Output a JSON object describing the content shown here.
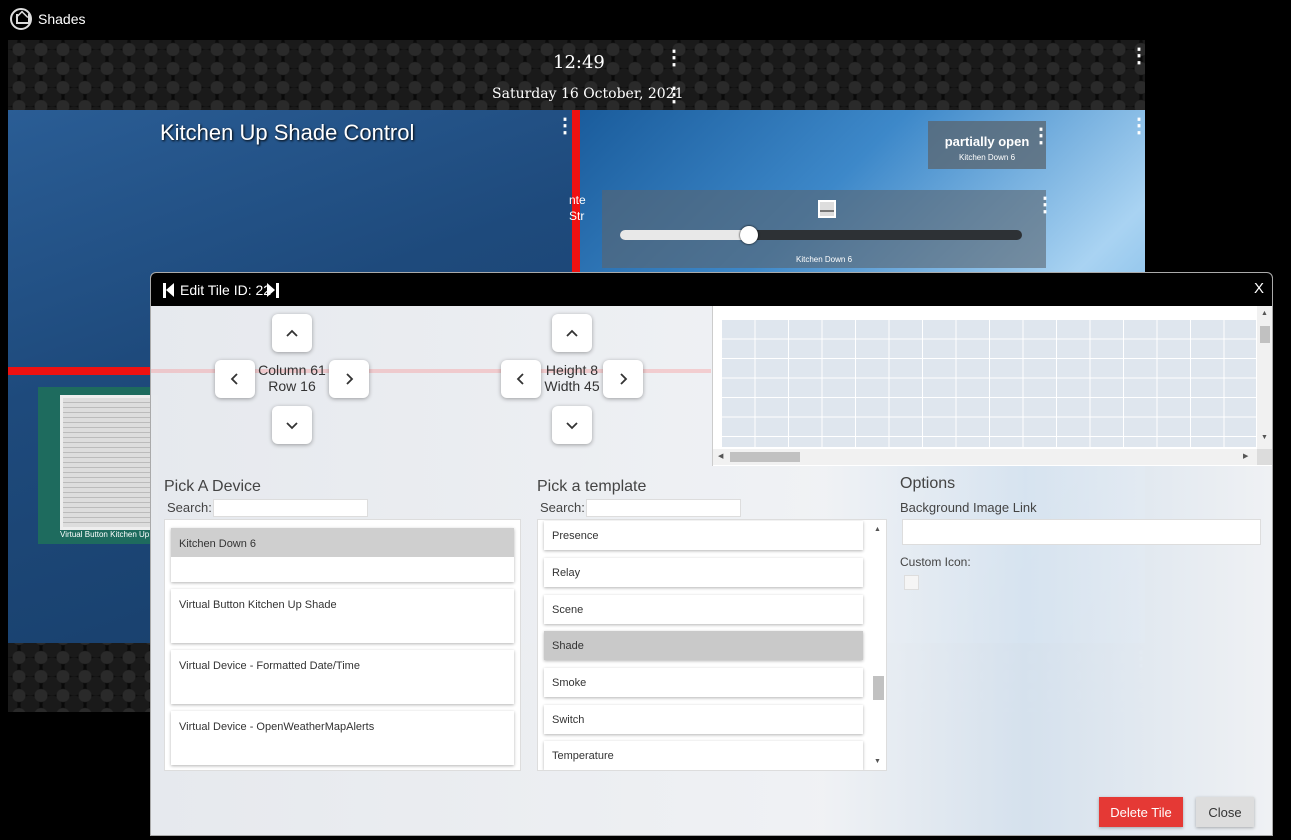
{
  "app": {
    "title": "Shades"
  },
  "header": {
    "time": "12:49",
    "date": "Saturday 16 October, 2021"
  },
  "tiles": {
    "left_title": "Kitchen Up Shade Control",
    "cut_text": "nte\nStr",
    "status": {
      "value": "partially open",
      "device": "Kitchen Down 6"
    },
    "slider": {
      "device": "Kitchen Down 6",
      "level": 0.32
    },
    "shade": {
      "label": "Virtual Button Kitchen Up"
    }
  },
  "modal": {
    "title": "Edit Tile ID: 22",
    "close_x": "X",
    "position": {
      "column": "Column 61",
      "row": "Row 16"
    },
    "size": {
      "height": "Height 8",
      "width": "Width 45"
    },
    "device_section": {
      "title": "Pick A Device",
      "search_label": "Search:",
      "items": [
        "Kitchen Down 6",
        "Virtual Button Kitchen Up Shade",
        "Virtual Device - Formatted Date/Time",
        "Virtual Device - OpenWeatherMapAlerts"
      ],
      "selected": "Kitchen Down 6"
    },
    "template_section": {
      "title": "Pick a template",
      "search_label": "Search:",
      "items": [
        "Presence",
        "Relay",
        "Scene",
        "Shade",
        "Smoke",
        "Switch",
        "Temperature"
      ],
      "selected": "Shade"
    },
    "options": {
      "title": "Options",
      "bg_image_label": "Background Image Link",
      "custom_icon_label": "Custom Icon:"
    },
    "buttons": {
      "delete": "Delete Tile",
      "close": "Close"
    }
  },
  "colors": {
    "delete_button": "#e53935",
    "accent_red": "#ee1111"
  }
}
